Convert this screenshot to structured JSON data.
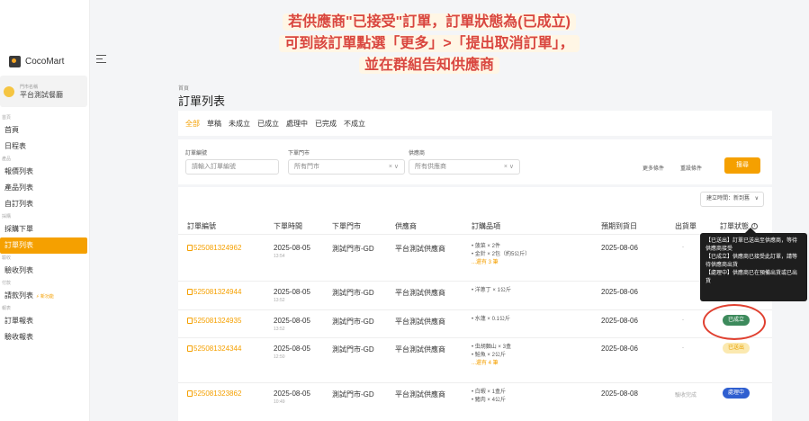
{
  "app": {
    "logo_text": "CocoMart",
    "store_label": "門市名稱",
    "store_name": "平台測試餐廳"
  },
  "sidebar": {
    "items": [
      {
        "label": "首頁",
        "type": "section"
      },
      {
        "label": "首頁",
        "type": "item"
      },
      {
        "label": "日程表",
        "type": "item"
      },
      {
        "label": "產品",
        "type": "section"
      },
      {
        "label": "報價列表",
        "type": "item"
      },
      {
        "label": "產品列表",
        "type": "item"
      },
      {
        "label": "自訂列表",
        "type": "item"
      },
      {
        "label": "採購",
        "type": "section"
      },
      {
        "label": "採購下單",
        "type": "item"
      },
      {
        "label": "訂單列表",
        "type": "item",
        "active": true
      },
      {
        "label": "驗收",
        "type": "section"
      },
      {
        "label": "驗收列表",
        "type": "item"
      },
      {
        "label": "付款",
        "type": "section"
      },
      {
        "label": "請款列表",
        "type": "item",
        "badge": "⚡ 新功能"
      },
      {
        "label": "報表",
        "type": "section"
      },
      {
        "label": "訂單報表",
        "type": "item"
      },
      {
        "label": "驗收報表",
        "type": "item"
      }
    ]
  },
  "page": {
    "breadcrumb": "首頁",
    "title": "訂單列表"
  },
  "tabs": [
    "全部",
    "草稿",
    "未成立",
    "已成立",
    "處理中",
    "已完成",
    "不成立"
  ],
  "filters": {
    "order_no_label": "訂單編號",
    "order_no_placeholder": "請輸入訂單編號",
    "store_label": "下單門市",
    "store_value": "所有門市",
    "supplier_label": "供應商",
    "supplier_value": "所有供應商",
    "more_conditions": "更多條件",
    "reset_conditions": "重設條件",
    "search_button": "搜尋"
  },
  "sort": {
    "value": "建立時間：新到舊",
    "chevron": "∨"
  },
  "table": {
    "headers": [
      "訂單編號",
      "下單時間",
      "下單門市",
      "供應商",
      "訂購品項",
      "預期到貨日",
      "出貨單",
      "訂單狀態"
    ],
    "rows": [
      {
        "order_no": "525081324962",
        "date": "2025-08-05",
        "time": "13:54",
        "store": "測試門市-GD",
        "supplier": "平台測試供應商",
        "items": [
          "• 菠菜 × 2件",
          "• 金針 × 2包（約5公斤）"
        ],
        "more": "...還有 3 筆",
        "eta": "2025-08-06",
        "shipment": "-",
        "status": ""
      },
      {
        "order_no": "525081324944",
        "date": "2025-08-05",
        "time": "13:52",
        "store": "測試門市-GD",
        "supplier": "平台測試供應商",
        "items": [
          "• 洋蔥丁 × 1公斤"
        ],
        "more": "",
        "eta": "2025-08-06",
        "shipment": "",
        "status": ""
      },
      {
        "order_no": "525081324935",
        "date": "2025-08-05",
        "time": "13:52",
        "store": "測試門市-GD",
        "supplier": "平台測試供應商",
        "items": [
          "• 水蓮 × 0.1公斤"
        ],
        "more": "",
        "eta": "2025-08-06",
        "shipment": "-",
        "status": "已成立"
      },
      {
        "order_no": "525081324344",
        "date": "2025-08-05",
        "time": "12:50",
        "store": "測試門市-GD",
        "supplier": "平台測試供應商",
        "items": [
          "• 虫胡麵山 × 3盒",
          "• 鮭魚 × 2公斤"
        ],
        "more": "...還有 4 筆",
        "eta": "2025-08-06",
        "shipment": "-",
        "status": "已送出"
      },
      {
        "order_no": "525081323862",
        "date": "2025-08-05",
        "time": "10:49",
        "store": "測試門市-GD",
        "supplier": "平台測試供應商",
        "items": [
          "• 白蝦 × 1盒斤",
          "• 豬肉 × 4公斤"
        ],
        "more": "",
        "eta": "2025-08-08",
        "shipment": "驗收完成",
        "status": "處理中"
      }
    ]
  },
  "tooltip": {
    "lines": [
      "【已送出】訂單已送出至供應商，等待供應商接受",
      "【已成立】供應商已接受此訂單，請等待供應商出貨",
      "【處理中】供應商已在預備出貨或已出貨"
    ]
  },
  "annotation": {
    "lines": [
      "若供應商\"已接受\"訂單，訂單狀態為(已成立)",
      "可到該訂單點選「更多」>「提出取消訂單」，",
      "並在群組告知供應商"
    ]
  },
  "colors": {
    "accent": "#f5a000",
    "established": "#3d8a5c",
    "sent": "#fbe9b0",
    "processing": "#2f5fd0",
    "annotation": "#d9463f"
  },
  "icons": {
    "doc": "document-icon",
    "info": "info-icon",
    "menu": "hamburger-icon",
    "logo": "cocomart-logo-icon"
  }
}
